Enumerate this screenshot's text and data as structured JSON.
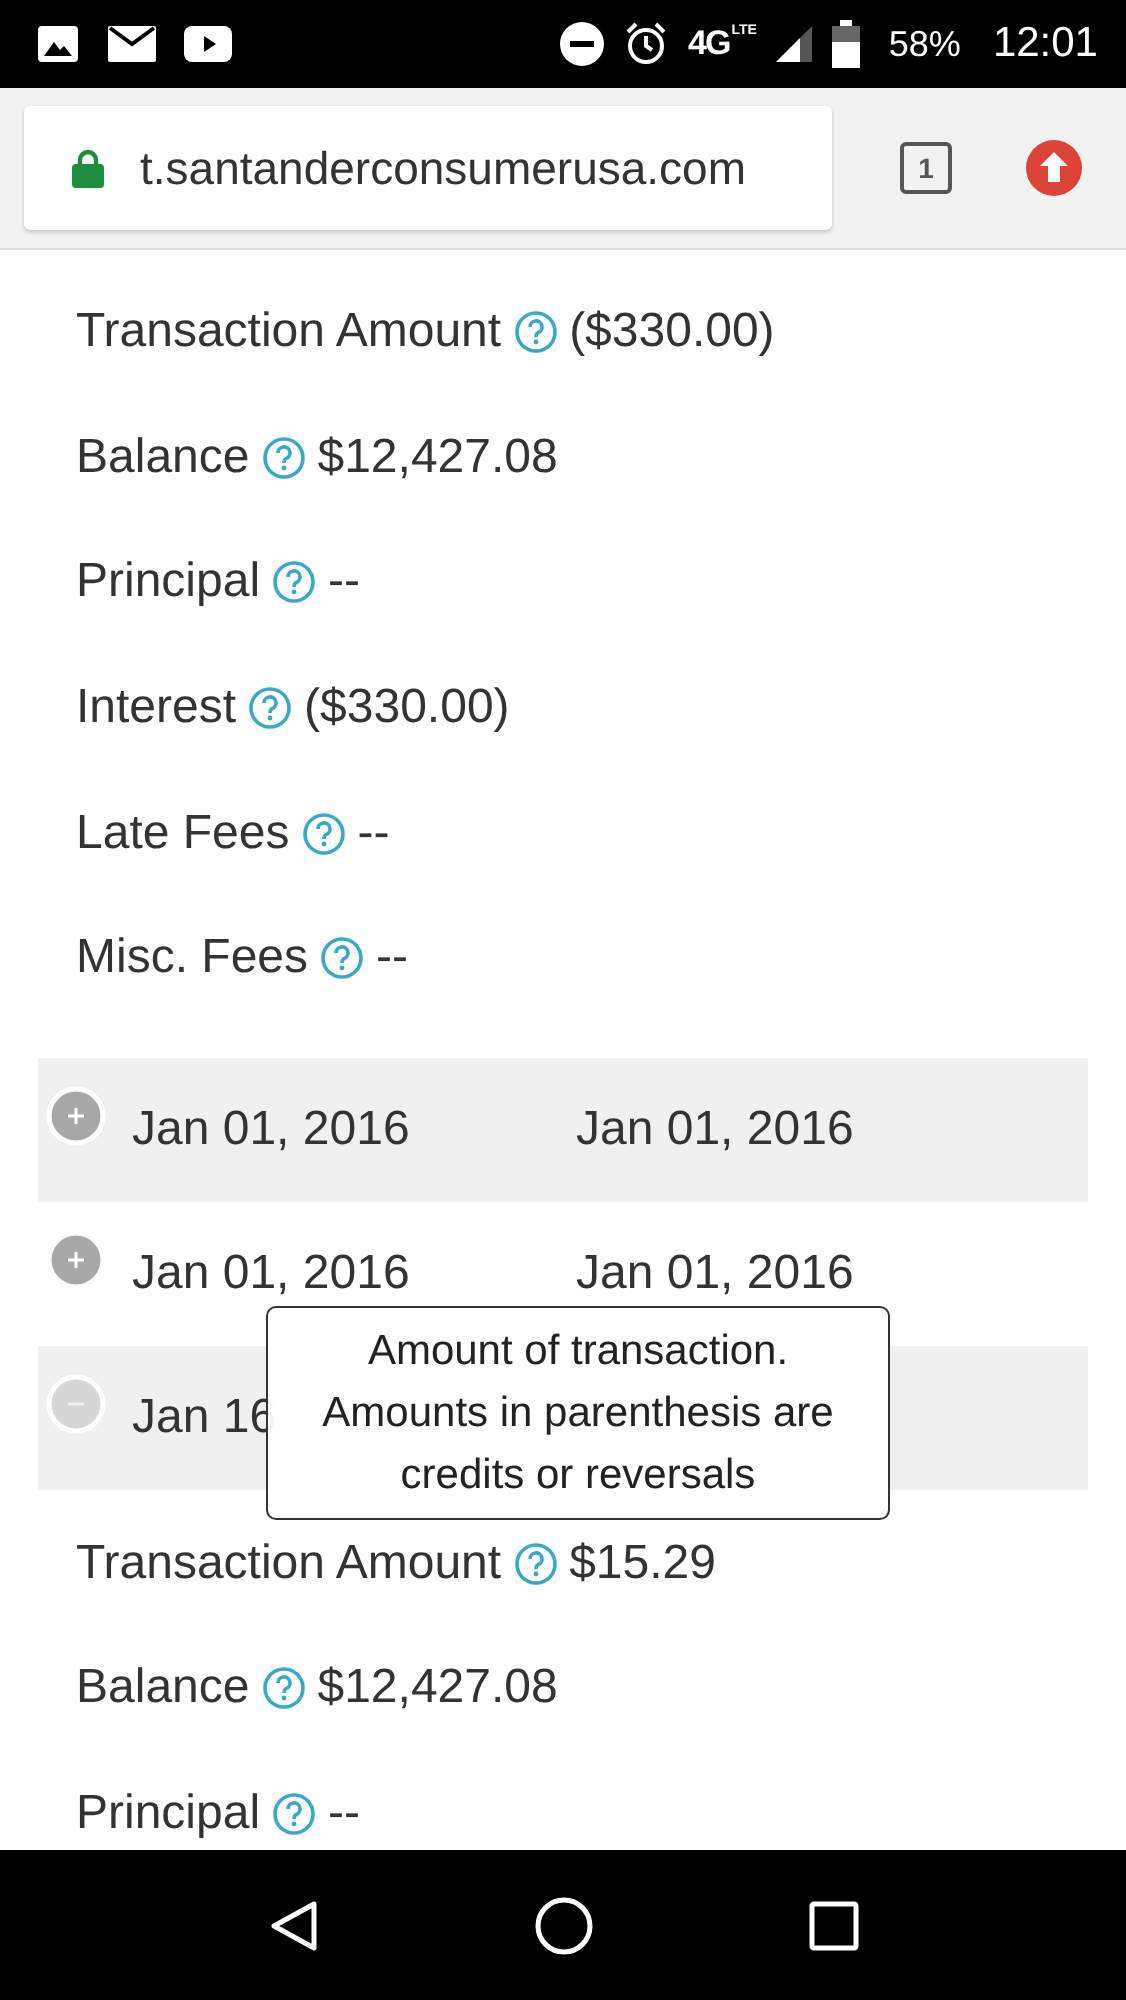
{
  "status_bar": {
    "network": "4G",
    "network_sub": "LTE",
    "battery": "58%",
    "time": "12:01"
  },
  "browser": {
    "url": "t.santanderconsumerusa.com",
    "tab_count": "1"
  },
  "details_top": [
    {
      "label": "Transaction Amount",
      "value": "($330.00)"
    },
    {
      "label": "Balance",
      "value": "$12,427.08"
    },
    {
      "label": "Principal",
      "value": "--"
    },
    {
      "label": "Interest",
      "value": "($330.00)"
    },
    {
      "label": "Late Fees",
      "value": "--"
    },
    {
      "label": "Misc. Fees",
      "value": "--"
    }
  ],
  "transactions": [
    {
      "expanded": false,
      "date_1": "Jan 01, 2016",
      "date_2": "Jan 01, 2016"
    },
    {
      "expanded": false,
      "date_1": "Jan 01, 2016",
      "date_2": "Jan 01, 2016"
    },
    {
      "expanded": true,
      "date_1": "Jan 16"
    }
  ],
  "tooltip": "Amount of transaction. Amounts in parenthesis are credits or reversals",
  "details_bottom": [
    {
      "label": "Transaction Amount",
      "value": "$15.29"
    },
    {
      "label": "Balance",
      "value": "$12,427.08"
    },
    {
      "label": "Principal",
      "value": "--"
    }
  ]
}
